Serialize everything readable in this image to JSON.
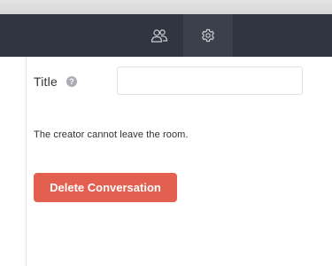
{
  "header": {
    "buttons": [
      {
        "icon": "users-icon"
      },
      {
        "icon": "gear-icon",
        "active": true
      }
    ],
    "colors": {
      "background": "#30363f",
      "active": "#3b414a",
      "icon": "#c9ced4"
    }
  },
  "form": {
    "title_label": "Title",
    "help_glyph": "?",
    "title_value": "",
    "title_placeholder": ""
  },
  "notice": "The creator cannot leave the room.",
  "delete_button": {
    "label": "Delete Conversation",
    "color": "#e35f4f"
  }
}
